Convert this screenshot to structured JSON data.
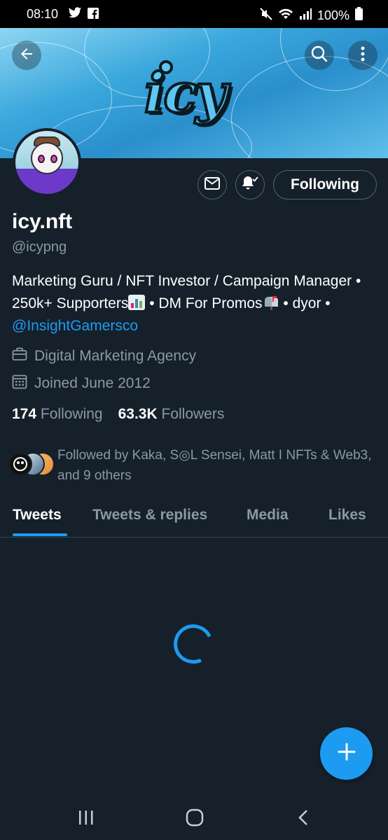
{
  "status_bar": {
    "time": "08:10",
    "battery": "100%",
    "icons_left": [
      "twitter-icon",
      "facebook-icon"
    ],
    "icons_right": [
      "mute-icon",
      "wifi-icon",
      "signal-icon",
      "battery-icon"
    ]
  },
  "banner": {
    "logo_text": "icy"
  },
  "profile": {
    "name": "icy.nft",
    "handle": "@icypng",
    "bio_part1": "Marketing Guru / NFT Investor / Campaign Manager • 250k+ Supporters",
    "bio_part2": " • DM For Promos",
    "bio_part3": " • dyor • ",
    "bio_mention": "@InsightGamersco",
    "category": "Digital Marketing Agency",
    "joined": "Joined June 2012",
    "following_count": "174",
    "following_label": "Following",
    "followers_count": "63.3K",
    "followers_label": "Followers",
    "followed_by": "Followed by Kaka, S◎L Sensei, Matt I NFTs & Web3, and 9 others"
  },
  "actions": {
    "follow_label": "Following"
  },
  "tabs": [
    {
      "label": "Tweets"
    },
    {
      "label": "Tweets & replies"
    },
    {
      "label": "Media"
    },
    {
      "label": "Likes"
    }
  ],
  "colors": {
    "background": "#15202b",
    "accent": "#1d9bf0",
    "muted": "#8b98a5"
  }
}
